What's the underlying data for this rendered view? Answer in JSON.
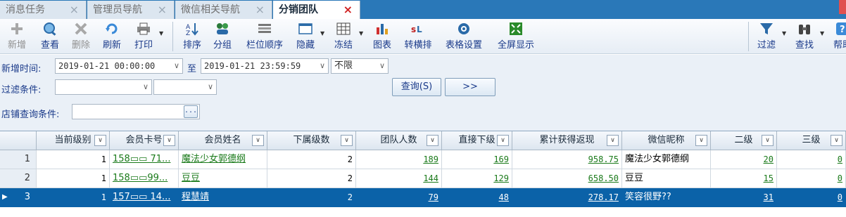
{
  "tabs": [
    {
      "label": "消息任务",
      "active": false
    },
    {
      "label": "管理员导航",
      "active": false
    },
    {
      "label": "微信相关导航",
      "active": false
    },
    {
      "label": "分销团队",
      "active": true
    }
  ],
  "tab_close_glyph": "×",
  "toolbar": {
    "add": "新增",
    "view": "查看",
    "delete": "删除",
    "refresh": "刷新",
    "print": "打印",
    "sort": "排序",
    "group": "分组",
    "column_order": "栏位顺序",
    "hide": "隐藏",
    "freeze": "冻结",
    "chart": "图表",
    "transpose": "转横排",
    "table_settings": "表格设置",
    "fullscreen": "全屏显示",
    "filter": "过滤",
    "find": "查找",
    "help": "帮助"
  },
  "filters": {
    "date_label": "新增时间:",
    "date_from": "2019-01-21 00:00:00",
    "to_label": "至",
    "date_to": "2019-01-21 23:59:59",
    "range_value": "不限",
    "condition_label": "过滤条件:",
    "shop_label": "店铺查询条件:",
    "shop_button": "...",
    "query_button": "查询(S)",
    "more_button": ">>"
  },
  "grid": {
    "columns": [
      "当前级别",
      "会员卡号",
      "会员姓名",
      "下属级数",
      "团队人数",
      "直接下级",
      "累计获得返现",
      "微信昵称",
      "二级",
      "三级"
    ],
    "filter_glyph": "∨",
    "rows": [
      {
        "no": "1",
        "level": "1",
        "card": "158▭▭ 71...",
        "name": "魔法少女郭德纲",
        "sub_levels": "2",
        "team": "189",
        "direct": "169",
        "cashback": "958.75",
        "nickname": "魔法少女郭德纲",
        "lv2": "20",
        "lv3": "0"
      },
      {
        "no": "2",
        "level": "1",
        "card": "158▭▭99...",
        "name": "豆豆",
        "sub_levels": "2",
        "team": "144",
        "direct": "129",
        "cashback": "658.50",
        "nickname": "豆豆",
        "lv2": "15",
        "lv3": "0"
      },
      {
        "no": "3",
        "level": "1",
        "card": "157▭▭ 14...",
        "name": "程慧靖",
        "sub_levels": "2",
        "team": "79",
        "direct": "48",
        "cashback": "278.17",
        "nickname": "笑容很野??",
        "lv2": "31",
        "lv3": "0",
        "selected": true
      }
    ]
  }
}
